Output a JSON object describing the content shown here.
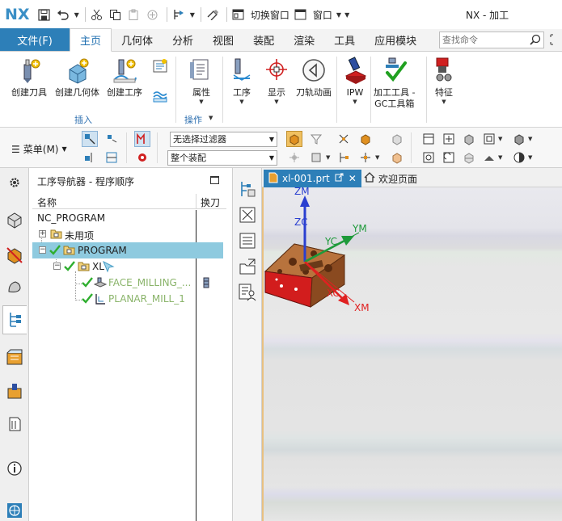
{
  "app": {
    "logo": "NX",
    "window_title": "NX - 加工"
  },
  "quick_access": {
    "switch_window_label": "切换窗口",
    "window_label": "窗口"
  },
  "tabs": {
    "file": "文件(F)",
    "items": [
      {
        "label": "主页",
        "active": true
      },
      {
        "label": "几何体",
        "active": false
      },
      {
        "label": "分析",
        "active": false
      },
      {
        "label": "视图",
        "active": false
      },
      {
        "label": "装配",
        "active": false
      },
      {
        "label": "渲染",
        "active": false
      },
      {
        "label": "工具",
        "active": false
      },
      {
        "label": "应用模块",
        "active": false
      }
    ],
    "search_placeholder": "查找命令"
  },
  "ribbon": {
    "create_tool": "创建刀具",
    "create_geometry": "创建几何体",
    "create_operation": "创建工序",
    "attributes": "属性",
    "operation": "工序",
    "display": "显示",
    "toolpath_animation": "刀轨动画",
    "ipw": "IPW",
    "mfg_tools_line1": "加工工具 -",
    "mfg_tools_line2": "GC工具箱",
    "feature": "特征",
    "group_insert": "插入",
    "group_operations": "操作"
  },
  "toolbar2": {
    "menu_label": "菜单(M)",
    "filter_select": "无选择过滤器",
    "assembly_select": "整个装配"
  },
  "navigator": {
    "title": "工序导航器 - 程序顺序",
    "col_name": "名称",
    "col_tool_change": "换刀",
    "rows": [
      {
        "name": "NC_PROGRAM"
      },
      {
        "name": "未用项"
      },
      {
        "name": "PROGRAM"
      },
      {
        "name": "XL"
      },
      {
        "name": "FACE_MILLING_..."
      },
      {
        "name": "PLANAR_MILL_1"
      }
    ]
  },
  "graphics": {
    "doc_tab": "xl-001.prt",
    "home_tab": "欢迎页面",
    "axes": {
      "zm": "ZM",
      "zc": "ZC",
      "yc": "YC",
      "ym": "YM",
      "xc": "XC",
      "xm": "XM"
    }
  },
  "colors": {
    "accent": "#2d7fb8",
    "selection": "#8ecadf",
    "check_green": "#2fae2f",
    "axis_red": "#e02020",
    "axis_green": "#1e9a3a",
    "axis_blue": "#2a3fd0"
  }
}
